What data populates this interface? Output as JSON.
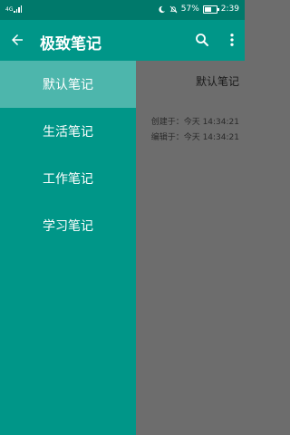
{
  "status_bar": {
    "carrier_text": "4G",
    "battery": "57%",
    "battery_level": 0.57,
    "time": "2:39"
  },
  "app_bar": {
    "title": "极致笔记",
    "icons": [
      "back-arrow-icon",
      "search-icon",
      "more-vert-icon"
    ]
  },
  "drawer": {
    "items": [
      {
        "label": "默认笔记",
        "active": true
      },
      {
        "label": "生活笔记",
        "active": false
      },
      {
        "label": "工作笔记",
        "active": false
      },
      {
        "label": "学习笔记",
        "active": false
      }
    ]
  },
  "note": {
    "title": "默认笔记",
    "created": "创建于：今天  14:34:21",
    "edited": "编辑于：今天  14:34:21"
  },
  "colors": {
    "status_bar": "#00796b",
    "app_bar": "#009688",
    "drawer": "#009688",
    "drawer_active": "#4db6ac",
    "scrim": "#6d6d6d"
  }
}
